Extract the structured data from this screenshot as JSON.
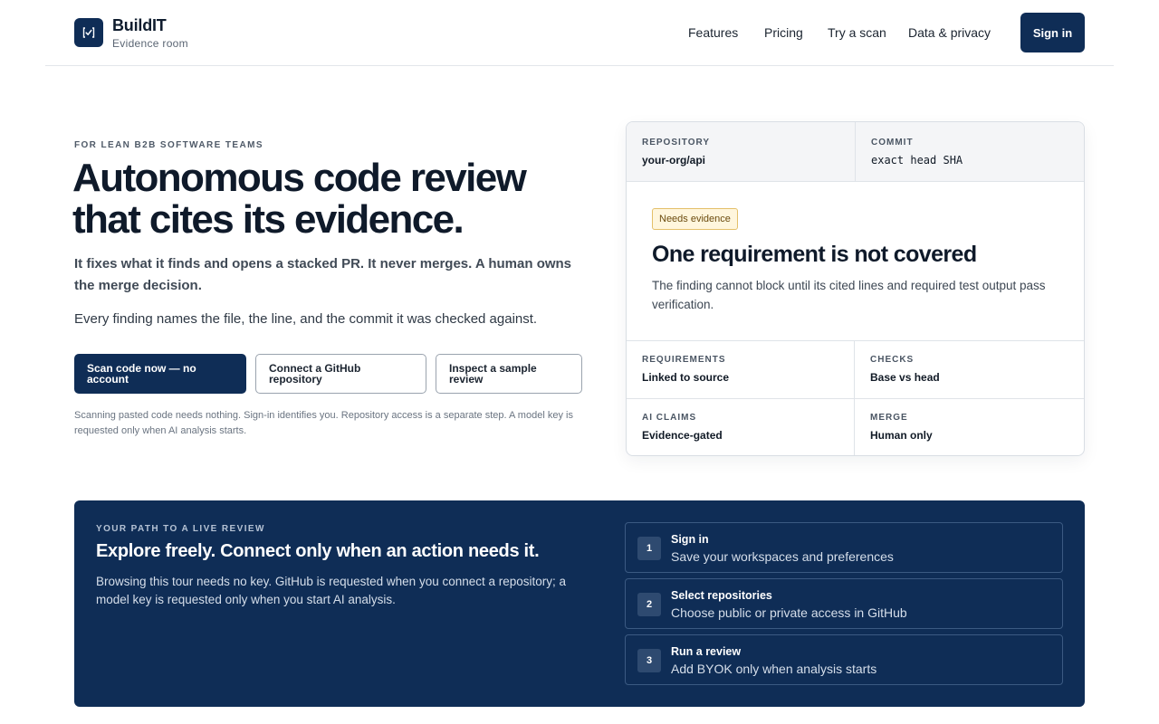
{
  "brand": {
    "name": "BuildIT",
    "subtitle": "Evidence room",
    "logo_icon": "check-bracket-icon"
  },
  "nav": {
    "items": [
      "Features",
      "Pricing",
      "Try a scan",
      "Data & privacy"
    ],
    "signin_label": "Sign in"
  },
  "hero": {
    "eyebrow": "FOR LEAN B2B SOFTWARE TEAMS",
    "title": "Autonomous code review that cites its evidence.",
    "lede": "It fixes what it finds and opens a stacked PR. It never merges. A human owns the merge decision.",
    "desc": "Every finding names the file, the line, and the commit it was checked against.",
    "cta_primary": "Scan code now — no account",
    "cta_github": "Connect a GitHub repository",
    "cta_sample": "Inspect a sample review",
    "note": "Scanning pasted code needs nothing. Sign-in identifies you. Repository access is a separate step. A model key is requested only when AI analysis starts."
  },
  "card": {
    "repository_label": "REPOSITORY",
    "repository_value": "your-org/api",
    "commit_label": "COMMIT",
    "commit_value": "exact head SHA",
    "badge": "Needs evidence",
    "finding_title": "One requirement is not covered",
    "finding_desc": "The finding cannot block until its cited lines and required test output pass verification.",
    "requirements_label": "REQUIREMENTS",
    "requirements_value": "Linked to source",
    "checks_label": "CHECKS",
    "checks_value": "Base vs head",
    "ai_label": "AI CLAIMS",
    "ai_value": "Evidence-gated",
    "merge_label": "MERGE",
    "merge_value": "Human only"
  },
  "band": {
    "eyebrow": "YOUR PATH TO A LIVE REVIEW",
    "title": "Explore freely. Connect only when an action needs it.",
    "desc": "Browsing this tour needs no key. GitHub is requested when you connect a repository; a model key is requested only when you start AI analysis.",
    "steps": [
      {
        "num": "1",
        "title": "Sign in",
        "sub": "Save your workspaces and preferences"
      },
      {
        "num": "2",
        "title": "Select repositories",
        "sub": "Choose public or private access in GitHub"
      },
      {
        "num": "3",
        "title": "Run a review",
        "sub": "Add BYOK only when analysis starts"
      }
    ]
  },
  "colors": {
    "navy": "#0f2d56",
    "badge_bg": "#fff6dd",
    "badge_border": "#e4c06a"
  }
}
